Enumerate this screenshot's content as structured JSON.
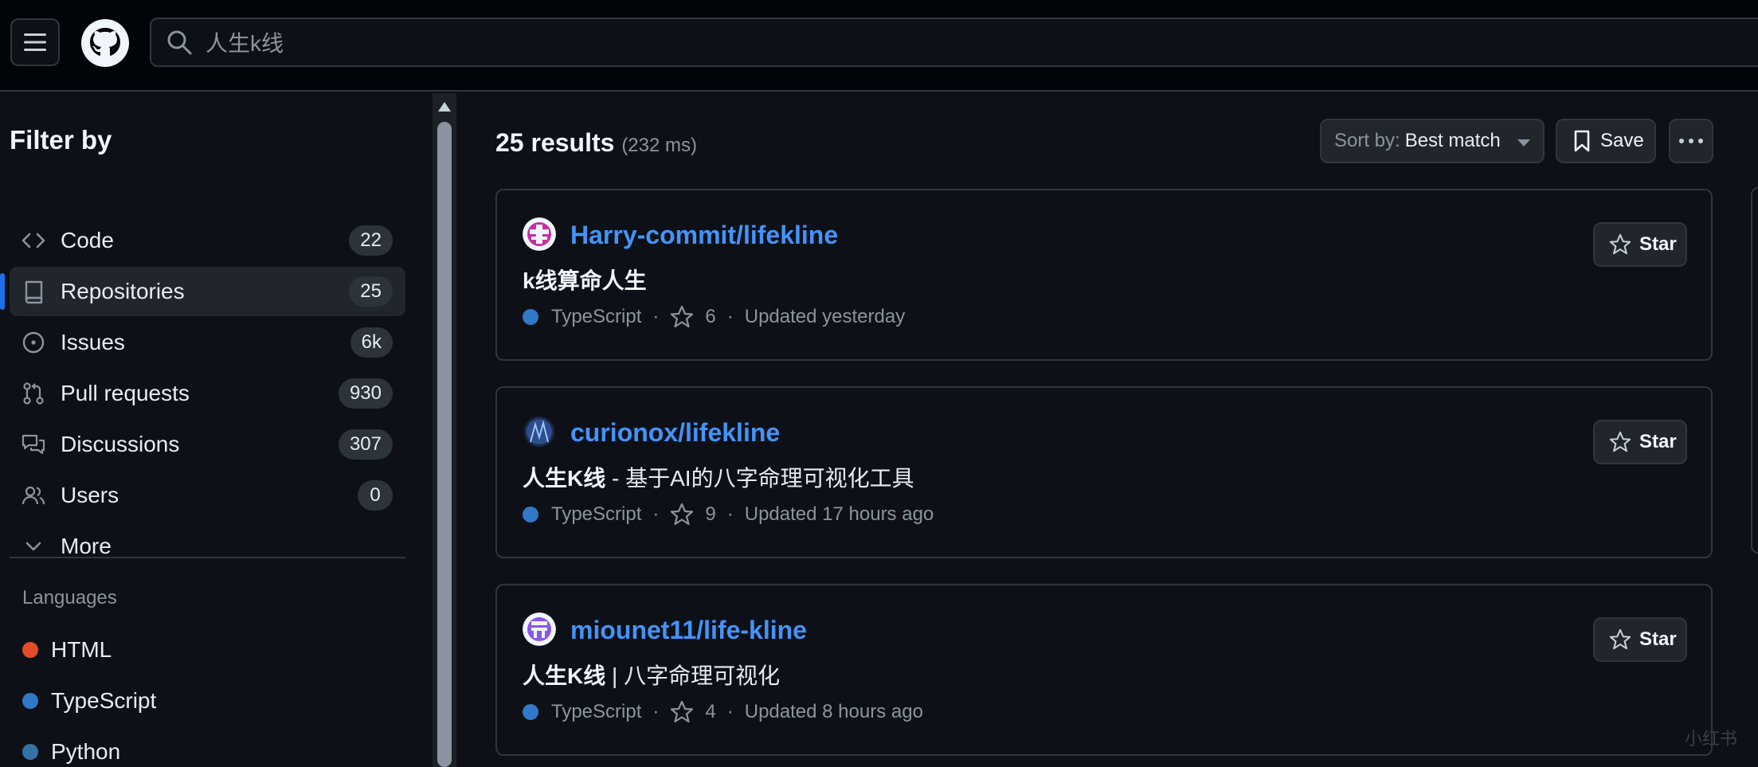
{
  "header": {
    "search_value": "人生k线",
    "icons": {
      "menu": "hamburger-icon",
      "logo": "github-logo",
      "search": "search-icon"
    }
  },
  "sidebar": {
    "title": "Filter by",
    "items": [
      {
        "label": "Code",
        "count": "22",
        "icon": "code-icon",
        "active": false
      },
      {
        "label": "Repositories",
        "count": "25",
        "icon": "repo-icon",
        "active": true
      },
      {
        "label": "Issues",
        "count": "6k",
        "icon": "issue-icon",
        "active": false
      },
      {
        "label": "Pull requests",
        "count": "930",
        "icon": "pull-request-icon",
        "active": false
      },
      {
        "label": "Discussions",
        "count": "307",
        "icon": "discussion-icon",
        "active": false
      },
      {
        "label": "Users",
        "count": "0",
        "icon": "users-icon",
        "active": false
      },
      {
        "label": "More",
        "icon": "chevron-down-icon"
      }
    ],
    "languages_title": "Languages",
    "languages": [
      {
        "label": "HTML",
        "color": "#e34c26"
      },
      {
        "label": "TypeScript",
        "color": "#3178c6"
      },
      {
        "label": "Python",
        "color": "#3572A5"
      }
    ]
  },
  "main": {
    "results_count": "25 results",
    "results_time": "(232 ms)",
    "sort_label": "Sort by:",
    "sort_value": "Best match",
    "save_label": "Save",
    "results": [
      {
        "repo": "Harry-commit/lifekline",
        "desc_bold": "k线算命人生",
        "desc_rest": "",
        "language": "TypeScript",
        "stars": "6",
        "updated": "Updated yesterday",
        "star_label": "Star"
      },
      {
        "repo": "curionox/lifekline",
        "desc_bold": "人生K线",
        "desc_rest": " - 基于AI的八字命理可视化工具",
        "language": "TypeScript",
        "stars": "9",
        "updated": "Updated 17 hours ago",
        "star_label": "Star"
      },
      {
        "repo": "miounet11/life-kline",
        "desc_bold": "人生K线",
        "desc_rest": " | 八字命理可视化",
        "language": "TypeScript",
        "stars": "4",
        "updated": "Updated 8 hours ago",
        "star_label": "Star"
      }
    ]
  },
  "watermark": "小红书",
  "colors": {
    "accent": "#1f6feb",
    "link": "#4493f8",
    "typescript": "#3178c6",
    "background": "#0d1117"
  }
}
